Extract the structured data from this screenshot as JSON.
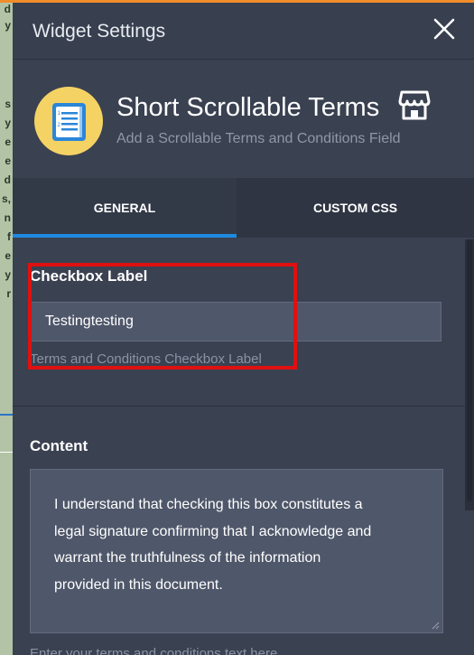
{
  "background": {
    "fragments": [
      "d",
      "y",
      "s",
      "y",
      "e",
      "e",
      "d",
      "s,",
      "n",
      "f",
      "e",
      "y",
      "r"
    ]
  },
  "header": {
    "title": "Widget Settings",
    "close_icon": "close-icon"
  },
  "widget": {
    "name": "Short Scrollable Terms",
    "description": "Add a Scrollable Terms and Conditions Field",
    "icon": "list-document-icon",
    "store_icon": "store-icon",
    "icon_bg_color": "#f5d264"
  },
  "tabs": [
    {
      "label": "GENERAL",
      "active": true
    },
    {
      "label": "CUSTOM CSS",
      "active": false
    }
  ],
  "checkbox_label": {
    "label": "Checkbox Label",
    "value": "Testingtesting",
    "helper": "Terms and Conditions Checkbox Label"
  },
  "content": {
    "label": "Content",
    "lines": [
      "I understand that checking this box constitutes a",
      "legal signature confirming that I acknowledge and",
      "warrant the truthfulness of the information",
      "provided in this document."
    ],
    "helper": "Enter your terms and conditions text here"
  },
  "colors": {
    "accent": "#1e8ae0",
    "highlight": "#e01010",
    "panel": "#3a4151"
  }
}
